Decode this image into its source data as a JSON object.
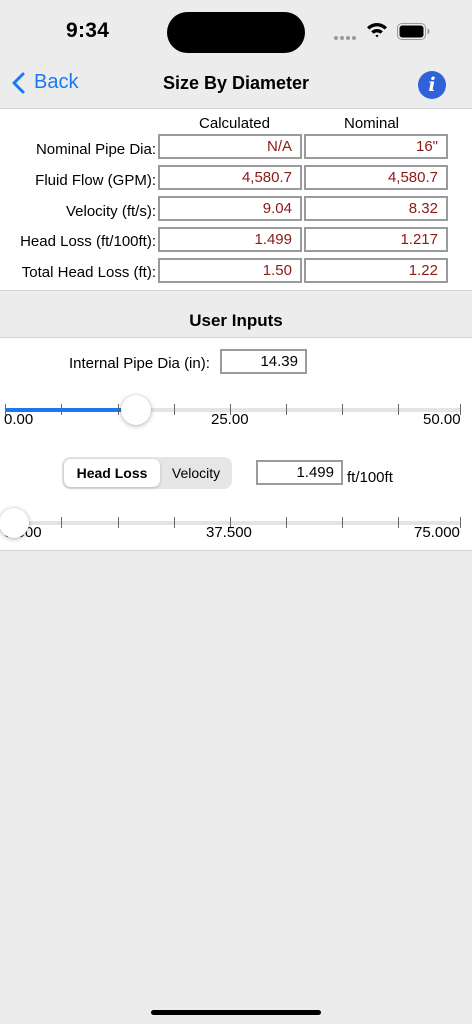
{
  "status_bar": {
    "time": "9:34"
  },
  "nav": {
    "back_label": "Back",
    "title": "Size By Diameter",
    "info_label": "i"
  },
  "results": {
    "col_calculated": "Calculated",
    "col_nominal": "Nominal",
    "rows": [
      {
        "label": "Nominal Pipe Dia:",
        "calculated": "N/A",
        "nominal": "16\""
      },
      {
        "label": "Fluid Flow (GPM):",
        "calculated": "4,580.7",
        "nominal": "4,580.7"
      },
      {
        "label": "Velocity (ft/s):",
        "calculated": "9.04",
        "nominal": "8.32"
      },
      {
        "label": "Head Loss (ft/100ft):",
        "calculated": "1.499",
        "nominal": "1.217"
      },
      {
        "label": "Total Head Loss (ft):",
        "calculated": "1.50",
        "nominal": "1.22"
      }
    ]
  },
  "user_inputs": {
    "title": "User Inputs",
    "diameter_label": "Internal Pipe Dia (in):",
    "diameter_value": "14.39",
    "diameter_slider": {
      "min_label": "0.00",
      "mid_label": "25.00",
      "max_label": "50.00",
      "level": 0.2878
    },
    "mode_options": [
      "Head Loss",
      "Velocity"
    ],
    "mode_selected": "Head Loss",
    "head_loss_value": "1.499",
    "head_loss_unit": "ft/100ft",
    "head_loss_slider": {
      "min_label": "0.000",
      "mid_label": "37.500",
      "max_label": "75.000",
      "level": 0.02
    }
  },
  "colors": {
    "accent": "#1779f3",
    "value_text": "#8a1a14",
    "info_button": "#2f62d9"
  }
}
